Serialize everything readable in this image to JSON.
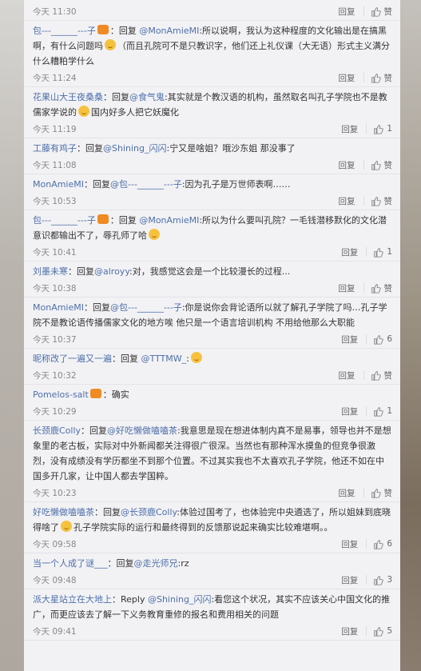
{
  "comments": [
    {
      "user": "",
      "segments": [],
      "time": "今天 11:30",
      "reply": "回复",
      "like": "赞"
    },
    {
      "user": "包---______---子",
      "badge": true,
      "segments": [
        {
          "t": "：回复 "
        },
        {
          "m": "@MonAmieMI"
        },
        {
          "t": ":所以说啊，我认为这种程度的文化输出是在搞黑啊，有什么问题吗"
        },
        {
          "e": "smile"
        },
        {
          "t": "（而且孔院可不是只教识字，他们还上礼仪课（大无语）形式主义满分什么糟粕学什么"
        }
      ],
      "time": "今天 11:24",
      "reply": "回复",
      "like": "赞"
    },
    {
      "user": "花果山大王夜桑桑",
      "segments": [
        {
          "t": "：回复"
        },
        {
          "m": "@食气鬼"
        },
        {
          "t": ":其实就是个教汉语的机构，虽然取名叫孔子学院也不是教儒家学说的"
        },
        {
          "e": "doge"
        },
        {
          "t": "国内好多人把它妖魔化"
        }
      ],
      "time": "今天 11:19",
      "reply": "回复",
      "like": "1"
    },
    {
      "user": "工藤有鸡子",
      "segments": [
        {
          "t": "：回复"
        },
        {
          "m": "@Shining_闪闪"
        },
        {
          "t": ":宁又是啥姐？哦沙东姐 那没事了"
        }
      ],
      "time": "今天 11:08",
      "reply": "回复",
      "like": "赞"
    },
    {
      "user": "MonAmieMI",
      "segments": [
        {
          "t": "：回复"
        },
        {
          "m": "@包---______---子"
        },
        {
          "t": ":因为孔子是万世师表啊……"
        }
      ],
      "time": "今天 10:53",
      "reply": "回复",
      "like": "赞"
    },
    {
      "user": "包---______---子",
      "badge": true,
      "segments": [
        {
          "t": "：回复 "
        },
        {
          "m": "@MonAmieMI"
        },
        {
          "t": ":所以为什么要叫孔院？一毛钱潜移默化的文化潜意识都输出不了，辱孔师了哈"
        },
        {
          "e": "smile"
        }
      ],
      "time": "今天 10:41",
      "reply": "回复",
      "like": "1"
    },
    {
      "user": "刘墨未寒",
      "segments": [
        {
          "t": "：回复"
        },
        {
          "m": "@alroyy"
        },
        {
          "t": ":对，我感觉这会是一个比较漫长的过程..."
        }
      ],
      "time": "今天 10:38",
      "reply": "回复",
      "like": "赞"
    },
    {
      "user": "MonAmieMI",
      "segments": [
        {
          "t": "：回复"
        },
        {
          "m": "@包---______---子"
        },
        {
          "t": ":你是说你会背论语所以就了解孔子学院了吗…孔子学院不是教论语传播儒家文化的地方唉  他只是一个语言培训机构 不用给他那么大职能"
        }
      ],
      "time": "今天 10:37",
      "reply": "回复",
      "like": "6"
    },
    {
      "user": "昵称改了一遍又一遍",
      "segments": [
        {
          "t": "：回复 "
        },
        {
          "m": "@TTTMW_"
        },
        {
          "t": ":"
        },
        {
          "e": "sad"
        }
      ],
      "time": "今天 10:32",
      "reply": "回复",
      "like": "赞"
    },
    {
      "user": "Pomelos-salt",
      "badge": true,
      "segments": [
        {
          "t": "：确实"
        }
      ],
      "time": "今天 10:29",
      "reply": "回复",
      "like": "1"
    },
    {
      "user": "长颈鹿Colly",
      "segments": [
        {
          "t": "：回复"
        },
        {
          "m": "@好吃懒做嗑嗑茶"
        },
        {
          "t": ":我意思是现在想进体制内真不是易事，领导也并不是想象里的老古板，实际对中外新闻都关注得很广很深。当然也有那种浑水摸鱼的但竞争很激烈，没有成绩没有学历都坐不到那个位置。不过其实我也不太喜欢孔子学院，他还不如在中国多开几家，让中国人都去学国粹。"
        }
      ],
      "time": "今天 10:23",
      "reply": "回复",
      "like": "赞"
    },
    {
      "user": "好吃懒做嗑嗑茶",
      "segments": [
        {
          "t": "：回复"
        },
        {
          "m": "@长颈鹿Colly"
        },
        {
          "t": ":体验过国考了，也体验完中央遴选了，所以姐妹到底晓得啥了"
        },
        {
          "e": "smile"
        },
        {
          "t": "孔子学院实际的运行和最终得到的反馈那说起来确实比较难堪啊。。"
        }
      ],
      "time": "今天 09:58",
      "reply": "回复",
      "like": "6"
    },
    {
      "user": "当一个人成了谜___",
      "segments": [
        {
          "t": "：回复"
        },
        {
          "m": "@走光师兄"
        },
        {
          "t": ":rz"
        }
      ],
      "time": "今天 09:48",
      "reply": "回复",
      "like": "3"
    },
    {
      "user": "派大星站立在大地上",
      "segments": [
        {
          "t": "：Reply "
        },
        {
          "m": "@Shining_闪闪"
        },
        {
          "t": ":看您这个状况，其实不应该关心中国文化的推广，而更应该去了解一下义务教育重修的报名和费用相关的问题"
        }
      ],
      "time": "今天 09:41",
      "reply": "回复",
      "like": "5"
    }
  ]
}
